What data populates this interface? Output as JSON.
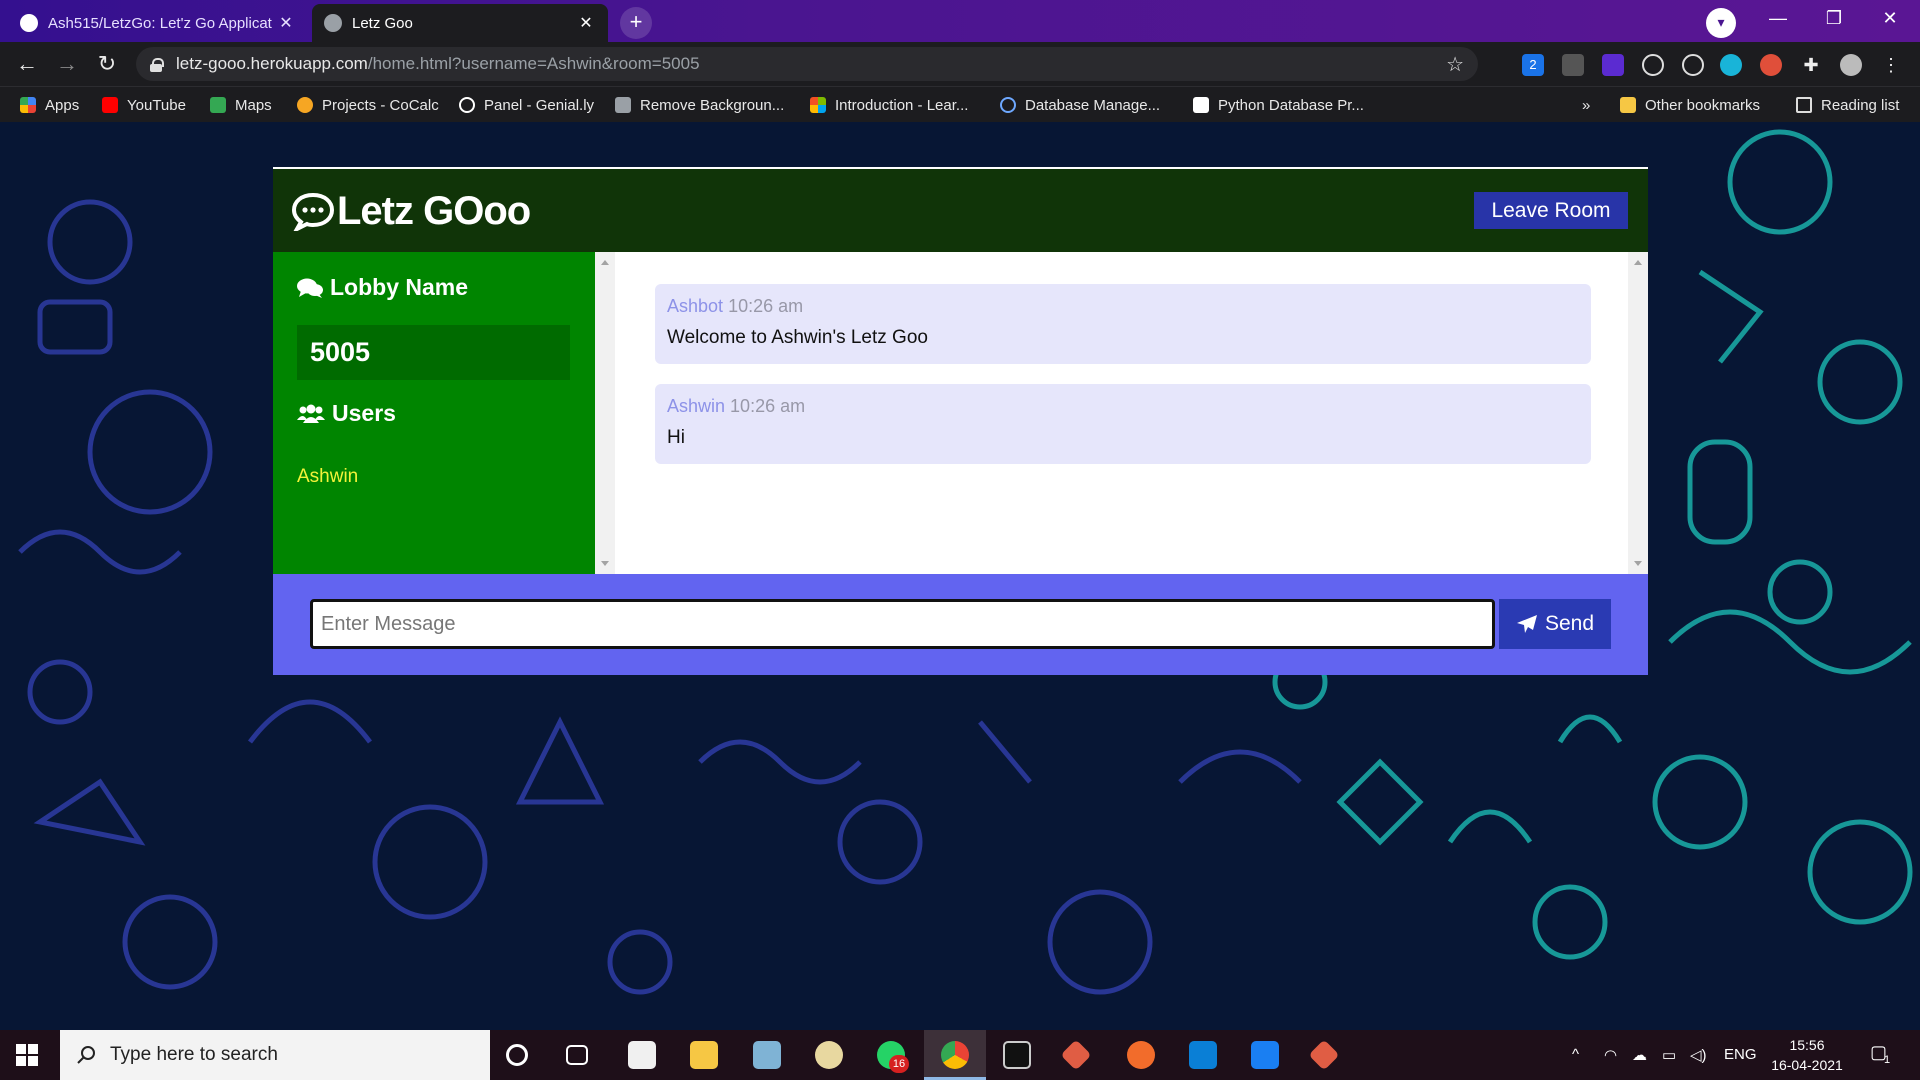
{
  "browser": {
    "tabs": [
      {
        "title": "Ash515/LetzGo: Let'z Go Applicat",
        "close": "✕"
      },
      {
        "title": "Letz Goo",
        "close": "✕"
      }
    ],
    "new_tab": "+",
    "url_host": "letz-gooo.herokuapp.com",
    "url_path": "/home.html?username=Ashwin&room=5005",
    "window_controls": {
      "minimize": "—",
      "restore": "❐",
      "close": "✕"
    },
    "extensions": [
      {
        "label": "2",
        "color": "#1a73e8"
      }
    ],
    "bookmarks": [
      {
        "label": "Apps",
        "color": "#e8453c"
      },
      {
        "label": "YouTube",
        "color": "#ff0000"
      },
      {
        "label": "Maps",
        "color": "#34a853"
      },
      {
        "label": "Projects - CoCalc",
        "color": "#f6a623"
      },
      {
        "label": "Panel - Genial.ly",
        "color": "#ffffff"
      },
      {
        "label": "Remove Backgroun...",
        "color": "#9aa0a6"
      },
      {
        "label": "Introduction - Lear...",
        "color": "#f25022"
      },
      {
        "label": "Database Manage...",
        "color": "#6ea8ff"
      },
      {
        "label": "Python Database Pr...",
        "color": "#ffffff"
      }
    ],
    "bookmarks_overflow": "»",
    "other_bookmarks": "Other bookmarks",
    "reading_list": "Reading list"
  },
  "app": {
    "logo_text": "Letz GOoo",
    "leave_button": "Leave Room",
    "sidebar": {
      "room_heading": "Lobby Name",
      "room_name": "5005",
      "users_heading": "Users",
      "users": [
        "Ashwin"
      ]
    },
    "messages": [
      {
        "author": "Ashbot",
        "time": "10:26 am",
        "text": "Welcome to Ashwin's Letz Goo"
      },
      {
        "author": "Ashwin",
        "time": "10:26 am",
        "text": "Hi"
      }
    ],
    "composer": {
      "placeholder": "Enter Message",
      "send_label": "Send"
    },
    "colors": {
      "header": "#103408",
      "sidebar": "#008500",
      "room_box": "#006b00",
      "composer": "#6264f0",
      "button": "#2834a8",
      "message_bg": "#e6e6fb",
      "username": "#f2f23a"
    }
  },
  "taskbar": {
    "search_placeholder": "Type here to search",
    "whatsapp_badge": "16",
    "language": "ENG",
    "time": "15:56",
    "date": "16-04-2021",
    "notification_count": "1"
  }
}
